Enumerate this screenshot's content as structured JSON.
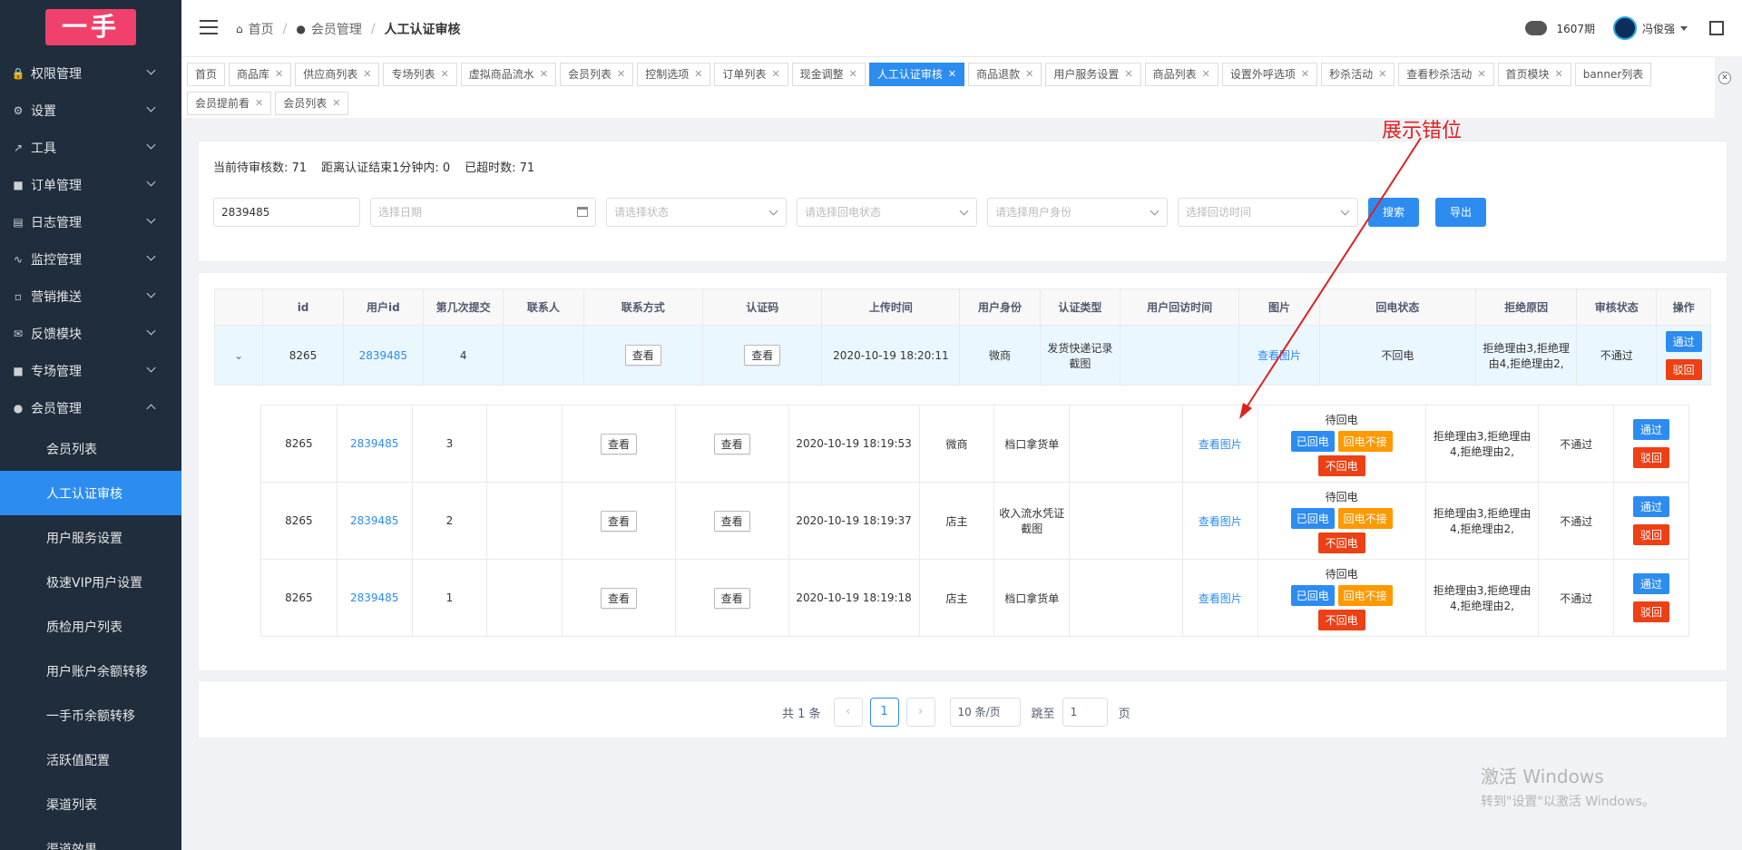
{
  "sidebar": {
    "logo": "一手",
    "items": [
      {
        "label": "权限管理",
        "icon": "lock"
      },
      {
        "label": "设置",
        "icon": "gear"
      },
      {
        "label": "工具",
        "icon": "wrench"
      },
      {
        "label": "订单管理",
        "icon": "list"
      },
      {
        "label": "日志管理",
        "icon": "document"
      },
      {
        "label": "监控管理",
        "icon": "pulse"
      },
      {
        "label": "营销推送",
        "icon": "card"
      },
      {
        "label": "反馈模块",
        "icon": "mail"
      },
      {
        "label": "专场管理",
        "icon": "list"
      },
      {
        "label": "会员管理",
        "icon": "users"
      }
    ],
    "subitems": [
      {
        "label": "会员列表"
      },
      {
        "label": "人工认证审核"
      },
      {
        "label": "用户服务设置"
      },
      {
        "label": "极速VIP用户设置"
      },
      {
        "label": "质检用户列表"
      },
      {
        "label": "用户账户余额转移"
      },
      {
        "label": "一手币余额转移"
      },
      {
        "label": "活跃值配置"
      },
      {
        "label": "渠道列表"
      },
      {
        "label": "渠道效果"
      }
    ]
  },
  "header": {
    "breadcrumb": [
      "首页",
      "会员管理",
      "人工认证审核"
    ],
    "period": "1607期",
    "user": "冯俊强"
  },
  "tabs": {
    "row1": [
      "首页",
      "商品库",
      "供应商列表",
      "专场列表",
      "虚拟商品流水",
      "会员列表",
      "控制选项",
      "订单列表",
      "现金调整",
      "人工认证审核",
      "商品退款",
      "用户服务设置",
      "商品列表",
      "设置外呼选项",
      "秒杀活动",
      "查看秒杀活动",
      "首页模块",
      "banner列表"
    ],
    "row2": [
      "会员提前看",
      "会员列表"
    ],
    "active": "人工认证审核"
  },
  "stats": {
    "pending": "当前待审核数: 71",
    "within_minute": "距离认证结束1分钟内: 0",
    "timeout": "已超时数: 71"
  },
  "filters": {
    "user_id_value": "2839485",
    "date_placeholder": "选择日期",
    "status_placeholder": "请选择状态",
    "callback_placeholder": "请选择回电状态",
    "identity_placeholder": "请选择用户身份",
    "visit_time_placeholder": "选择回访时间",
    "search_label": "搜索",
    "export_label": "导出"
  },
  "table": {
    "headers": [
      "",
      "id",
      "用户id",
      "第几次提交",
      "联系人",
      "联系方式",
      "认证码",
      "上传时间",
      "用户身份",
      "认证类型",
      "用户回访时间",
      "图片",
      "回电状态",
      "拒绝原因",
      "审核状态",
      "操作"
    ],
    "main_row": {
      "id": "8265",
      "user_id": "2839485",
      "submit_no": "4",
      "contact": "",
      "contact_btn": "查看",
      "code_btn": "查看",
      "upload_time": "2020-10-19 18:20:11",
      "identity": "微商",
      "auth_type": "发货快递记录截图",
      "visit_time": "",
      "image": "查看图片",
      "callback": "不回电",
      "reason": "拒绝理由3,拒绝理由4,拒绝理由2,",
      "status": "不通过",
      "pass": "通过",
      "reject": "驳回"
    },
    "sub_rows": [
      {
        "id": "8265",
        "user_id": "2839485",
        "submit_no": "3",
        "contact_btn": "查看",
        "code_btn": "查看",
        "upload_time": "2020-10-19 18:19:53",
        "identity": "微商",
        "auth_type": "档口拿货单",
        "image": "查看图片",
        "callback_title": "待回电",
        "btn_called": "已回电",
        "btn_noanswer": "回电不接",
        "btn_nocall": "不回电",
        "reason": "拒绝理由3,拒绝理由4,拒绝理由2,",
        "status": "不通过",
        "pass": "通过",
        "reject": "驳回"
      },
      {
        "id": "8265",
        "user_id": "2839485",
        "submit_no": "2",
        "contact_btn": "查看",
        "code_btn": "查看",
        "upload_time": "2020-10-19 18:19:37",
        "identity": "店主",
        "auth_type": "收入流水凭证截图",
        "image": "查看图片",
        "callback_title": "待回电",
        "btn_called": "已回电",
        "btn_noanswer": "回电不接",
        "btn_nocall": "不回电",
        "reason": "拒绝理由3,拒绝理由4,拒绝理由2,",
        "status": "不通过",
        "pass": "通过",
        "reject": "驳回"
      },
      {
        "id": "8265",
        "user_id": "2839485",
        "submit_no": "1",
        "contact_btn": "查看",
        "code_btn": "查看",
        "upload_time": "2020-10-19 18:19:18",
        "identity": "店主",
        "auth_type": "档口拿货单",
        "image": "查看图片",
        "callback_title": "待回电",
        "btn_called": "已回电",
        "btn_noanswer": "回电不接",
        "btn_nocall": "不回电",
        "reason": "拒绝理由3,拒绝理由4,拒绝理由2,",
        "status": "不通过",
        "pass": "通过",
        "reject": "驳回"
      }
    ]
  },
  "pagination": {
    "total": "共 1 条",
    "current": "1",
    "page_size": "10 条/页",
    "jump_label": "跳至",
    "jump_value": "1",
    "page_unit": "页"
  },
  "annotation": {
    "text": "展示错位"
  },
  "watermark": {
    "line1": "激活 Windows",
    "line2": "转到\"设置\"以激活 Windows。"
  },
  "colors": {
    "primary": "#2d8cf0",
    "danger": "#ed4014",
    "warning": "#ff9900",
    "sidebar": "#1f2d3d",
    "logo": "#f0416c"
  }
}
